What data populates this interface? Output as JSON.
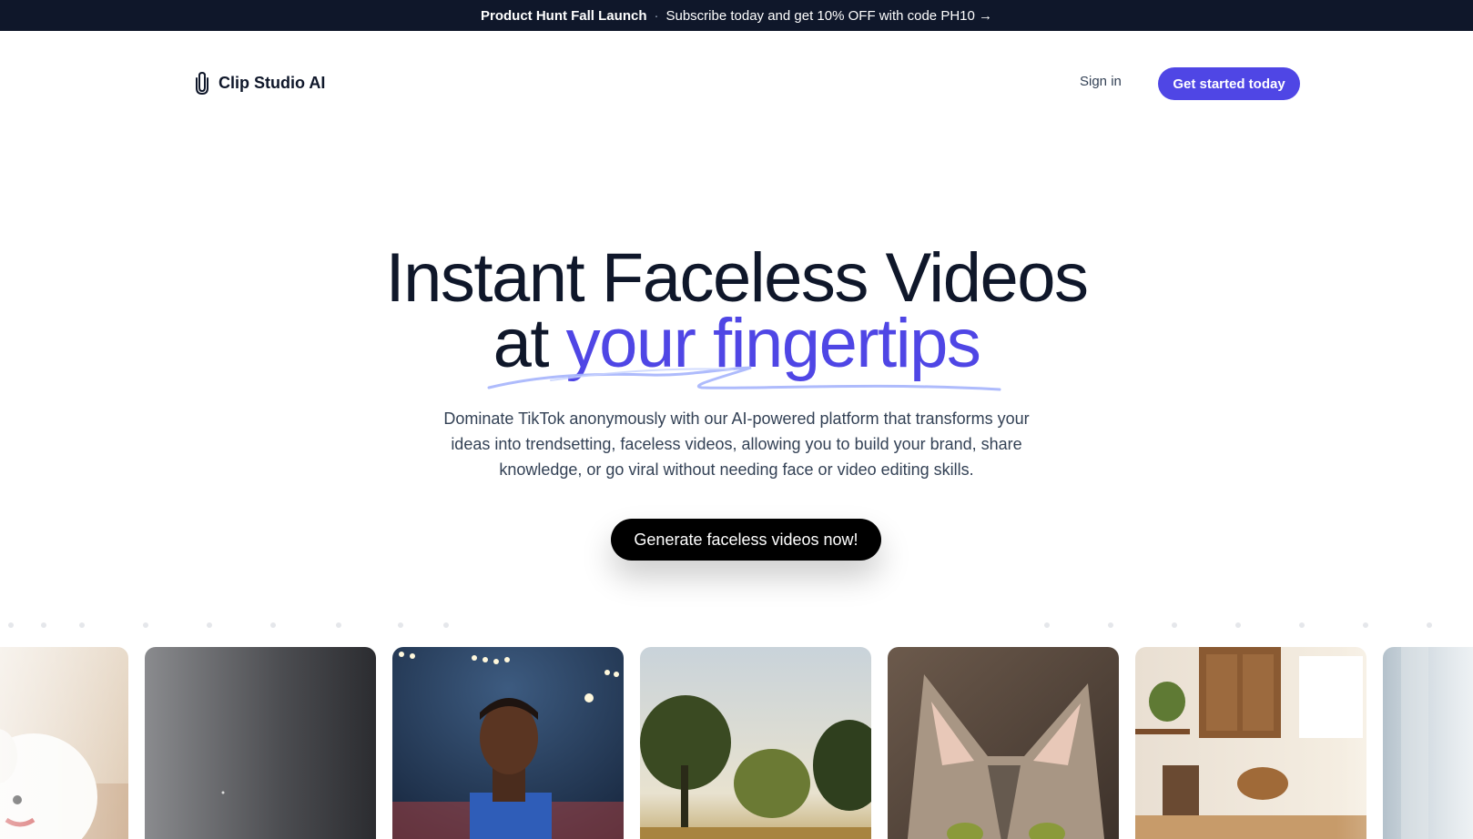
{
  "banner": {
    "highlight": "Product Hunt Fall Launch",
    "separator": "·",
    "message": "Subscribe today and get 10% OFF with code PH10 →"
  },
  "header": {
    "logo_icon": "paperclip-icon",
    "brand": "Clip Studio AI",
    "signin_label": "Sign in",
    "cta_label": "Get started today"
  },
  "hero": {
    "title_line1": "Instant Faceless Videos",
    "title_line2_prefix": "at",
    "title_line2_accent": "your fingertips",
    "subtitle": "Dominate TikTok anonymously with our AI-powered platform that transforms your ideas into trendsetting, faceless videos, allowing you to build your brand, share knowledge, or go viral without needing face or video editing skills.",
    "cta_label": "Generate faceless videos now!"
  },
  "gallery": {
    "items": [
      {
        "subject": "white fluffy dog"
      },
      {
        "subject": "dark gray gradient"
      },
      {
        "subject": "soccer player in stadium"
      },
      {
        "subject": "trees in field at sunset"
      },
      {
        "subject": "tabby cat close-up"
      },
      {
        "subject": "sunlit kitchen"
      },
      {
        "subject": "window with curtains"
      }
    ]
  },
  "colors": {
    "accent": "#4f46e5",
    "banner_bg": "#0f172a",
    "text_dark": "#0f172a",
    "cta_dark": "#000000"
  }
}
